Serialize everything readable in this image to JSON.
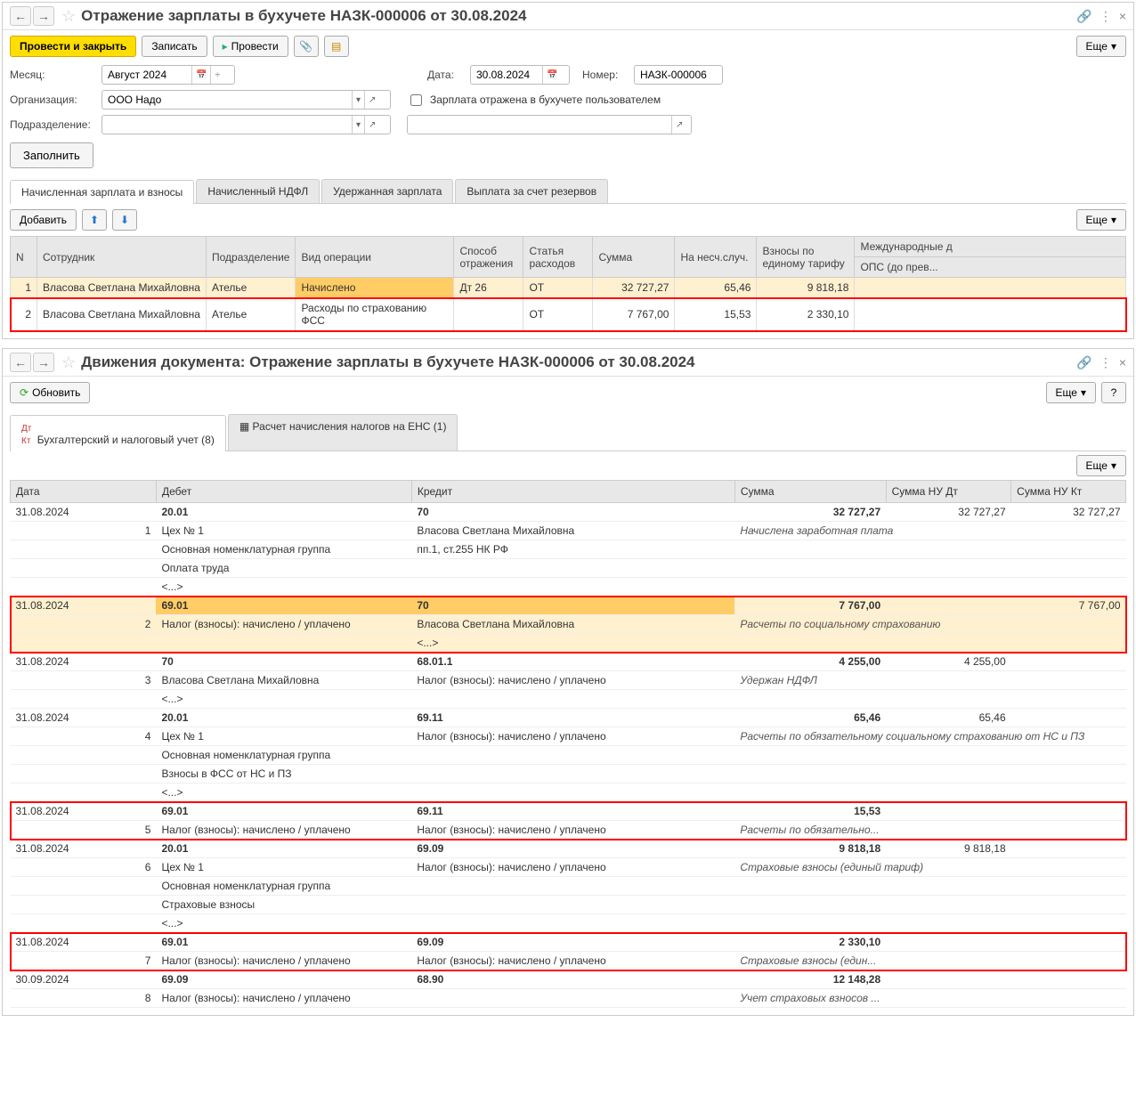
{
  "win1": {
    "title": "Отражение зарплаты в бухучете НАЗК-000006 от 30.08.2024",
    "toolbar": {
      "post_close": "Провести и закрыть",
      "save": "Записать",
      "post": "Провести",
      "more": "Еще"
    },
    "form": {
      "month_label": "Месяц:",
      "month_value": "Август 2024",
      "date_label": "Дата:",
      "date_value": "30.08.2024",
      "number_label": "Номер:",
      "number_value": "НАЗК-000006",
      "org_label": "Организация:",
      "org_value": "ООО Надо",
      "dept_label": "Подразделение:",
      "dept_value": "",
      "reflected_label": "Зарплата отражена в бухучете пользователем",
      "fill": "Заполнить"
    },
    "tabs": {
      "t1": "Начисленная зарплата и взносы",
      "t2": "Начисленный НДФЛ",
      "t3": "Удержанная зарплата",
      "t4": "Выплата за счет резервов"
    },
    "subtoolbar": {
      "add": "Добавить",
      "more": "Еще"
    },
    "table": {
      "headers": {
        "n": "N",
        "emp": "Сотрудник",
        "dep": "Подразделение",
        "op": "Вид операции",
        "refl": "Способ отражения",
        "art": "Статья расходов",
        "sum": "Сумма",
        "ns": "На несч.случ.",
        "tar": "Взносы по единому тарифу",
        "intl": "Международные д",
        "ops": "ОПС (до прев..."
      },
      "rows": [
        {
          "n": "1",
          "emp": "Власова Светлана Михайловна",
          "dep": "Ателье",
          "op": "Начислено",
          "refl": "Дт 26",
          "art": "ОТ",
          "sum": "32 727,27",
          "ns": "65,46",
          "tar": "9 818,18"
        },
        {
          "n": "2",
          "emp": "Власова Светлана Михайловна",
          "dep": "Ателье",
          "op": "Расходы по страхованию ФСС",
          "refl": "",
          "art": "ОТ",
          "sum": "7 767,00",
          "ns": "15,53",
          "tar": "2 330,10"
        }
      ]
    }
  },
  "win2": {
    "title": "Движения документа: Отражение зарплаты в бухучете НАЗК-000006 от 30.08.2024",
    "toolbar": {
      "refresh": "Обновить",
      "more": "Еще"
    },
    "tabs": {
      "t1": "Бухгалтерский и налоговый учет (8)",
      "t2": "Расчет начисления налогов на ЕНС (1)"
    },
    "more": "Еще",
    "headers": {
      "date": "Дата",
      "debit": "Дебет",
      "credit": "Кредит",
      "sum": "Сумма",
      "nudt": "Сумма НУ Дт",
      "nukt": "Сумма НУ Кт"
    },
    "entries": [
      {
        "date": "31.08.2024",
        "n": "1",
        "d": "20.01",
        "c": "70",
        "sum": "32 727,27",
        "nudt": "32 727,27",
        "nukt": "32 727,27",
        "d1": "Цех № 1",
        "c1": "Власова Светлана Михайловна",
        "desc": "Начислена заработная плата",
        "d2": "Основная номенклатурная группа",
        "c2": "пп.1, ст.255 НК РФ",
        "d3": "Оплата труда",
        "d4": "<...>",
        "red": false,
        "hl": false
      },
      {
        "date": "31.08.2024",
        "n": "2",
        "d": "69.01",
        "c": "70",
        "sum": "7 767,00",
        "nudt": "",
        "nukt": "7 767,00",
        "d1": "Налог (взносы): начислено / уплачено",
        "c1": "Власова Светлана Михайловна",
        "desc": "Расчеты по социальному страхованию",
        "d2": "",
        "c2": "<...>",
        "d3": "",
        "d4": "",
        "red": true,
        "hl": true
      },
      {
        "date": "31.08.2024",
        "n": "3",
        "d": "70",
        "c": "68.01.1",
        "sum": "4 255,00",
        "nudt": "4 255,00",
        "nukt": "",
        "d1": "Власова Светлана Михайловна",
        "c1": "Налог (взносы): начислено / уплачено",
        "desc": "Удержан НДФЛ",
        "d2": "<...>",
        "c2": "",
        "d3": "",
        "d4": "",
        "red": false,
        "hl": false
      },
      {
        "date": "31.08.2024",
        "n": "4",
        "d": "20.01",
        "c": "69.11",
        "sum": "65,46",
        "nudt": "65,46",
        "nukt": "",
        "d1": "Цех № 1",
        "c1": "Налог (взносы): начислено / уплачено",
        "desc": "Расчеты по обязательному социальному страхованию от НС и ПЗ",
        "d2": "Основная номенклатурная группа",
        "c2": "",
        "d3": "Взносы в ФСС от НС и ПЗ",
        "d4": "<...>",
        "red": false,
        "hl": false
      },
      {
        "date": "31.08.2024",
        "n": "5",
        "d": "69.01",
        "c": "69.11",
        "sum": "15,53",
        "nudt": "",
        "nukt": "",
        "d1": "Налог (взносы): начислено / уплачено",
        "c1": "Налог (взносы): начислено / уплачено",
        "desc": "Расчеты по обязательно...",
        "d2": "",
        "c2": "",
        "d3": "",
        "d4": "",
        "red": true,
        "hl": false
      },
      {
        "date": "31.08.2024",
        "n": "6",
        "d": "20.01",
        "c": "69.09",
        "sum": "9 818,18",
        "nudt": "9 818,18",
        "nukt": "",
        "d1": "Цех № 1",
        "c1": "Налог (взносы): начислено / уплачено",
        "desc": "Страховые взносы (единый тариф)",
        "d2": "Основная номенклатурная группа",
        "c2": "",
        "d3": "Страховые взносы",
        "d4": "<...>",
        "red": false,
        "hl": false
      },
      {
        "date": "31.08.2024",
        "n": "7",
        "d": "69.01",
        "c": "69.09",
        "sum": "2 330,10",
        "nudt": "",
        "nukt": "",
        "d1": "Налог (взносы): начислено / уплачено",
        "c1": "Налог (взносы): начислено / уплачено",
        "desc": "Страховые взносы (един...",
        "d2": "",
        "c2": "",
        "d3": "",
        "d4": "",
        "red": true,
        "hl": false
      },
      {
        "date": "30.09.2024",
        "n": "8",
        "d": "69.09",
        "c": "68.90",
        "sum": "12 148,28",
        "nudt": "",
        "nukt": "",
        "d1": "Налог (взносы): начислено / уплачено",
        "c1": "",
        "desc": "Учет страховых взносов ...",
        "d2": "",
        "c2": "",
        "d3": "",
        "d4": "",
        "red": false,
        "hl": false
      }
    ]
  }
}
